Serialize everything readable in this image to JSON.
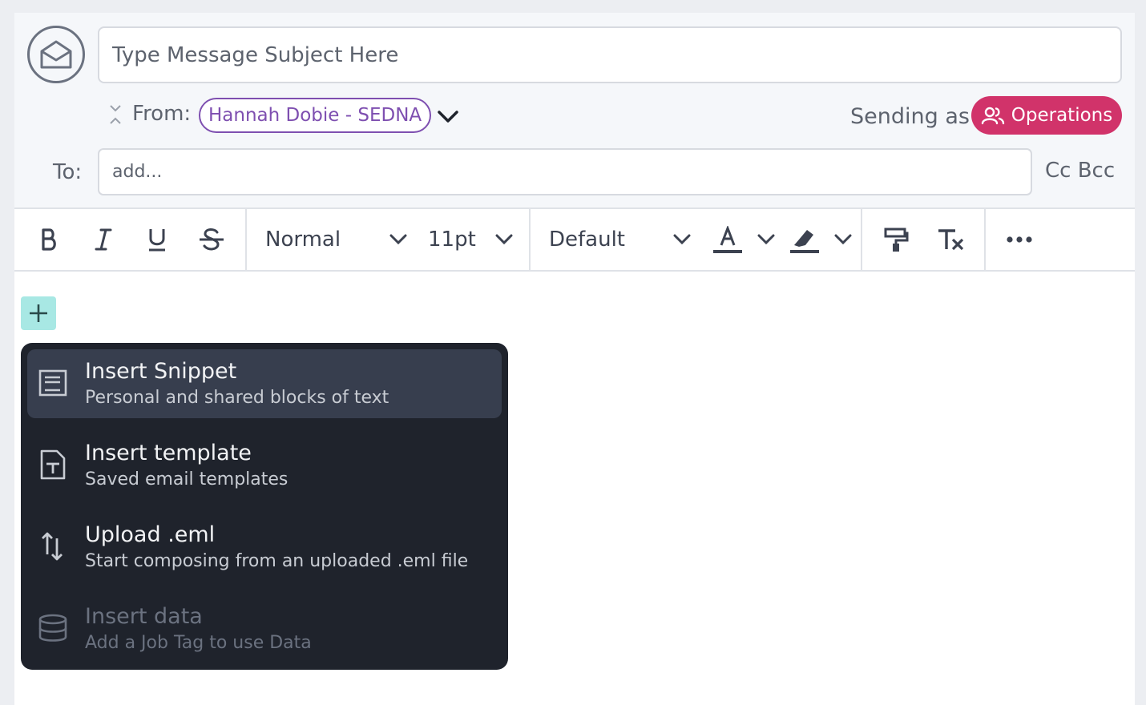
{
  "header": {
    "subject_placeholder": "Type Message Subject Here",
    "from_label": "From:",
    "from_value": "Hannah Dobie - SEDNA",
    "sending_as_label": "Sending as",
    "sending_as_value": "Operations",
    "to_label": "To:",
    "to_placeholder": "add...",
    "cc_label": "Cc",
    "bcc_label": "Bcc"
  },
  "toolbar": {
    "bold_icon": "bold-icon",
    "italic_icon": "italic-icon",
    "underline_icon": "underline-icon",
    "strike_icon": "strikethrough-icon",
    "paragraph_style": "Normal",
    "font_size": "11pt",
    "font_family": "Default",
    "text_color_icon": "text-color-icon",
    "highlight_icon": "highlight-icon",
    "format_painter_icon": "format-painter-icon",
    "clear_format_icon": "clear-format-icon",
    "more_icon": "more-icon"
  },
  "colors": {
    "accent_teal": "#a8e8e4",
    "badge_pink": "#d1336a",
    "chip_purple": "#7e4fb0",
    "menu_bg": "#1f232c",
    "menu_active": "#373e4e"
  },
  "insert_menu": {
    "items": [
      {
        "title": "Insert Snippet",
        "subtitle": "Personal and shared blocks of text",
        "icon": "snippet-icon",
        "state": "active"
      },
      {
        "title": "Insert template",
        "subtitle": "Saved email templates",
        "icon": "template-icon",
        "state": "normal"
      },
      {
        "title": "Upload .eml",
        "subtitle": "Start composing from an uploaded .eml file",
        "icon": "upload-icon",
        "state": "normal"
      },
      {
        "title": "Insert data",
        "subtitle": "Add a Job Tag to use Data",
        "icon": "database-icon",
        "state": "disabled"
      }
    ]
  }
}
